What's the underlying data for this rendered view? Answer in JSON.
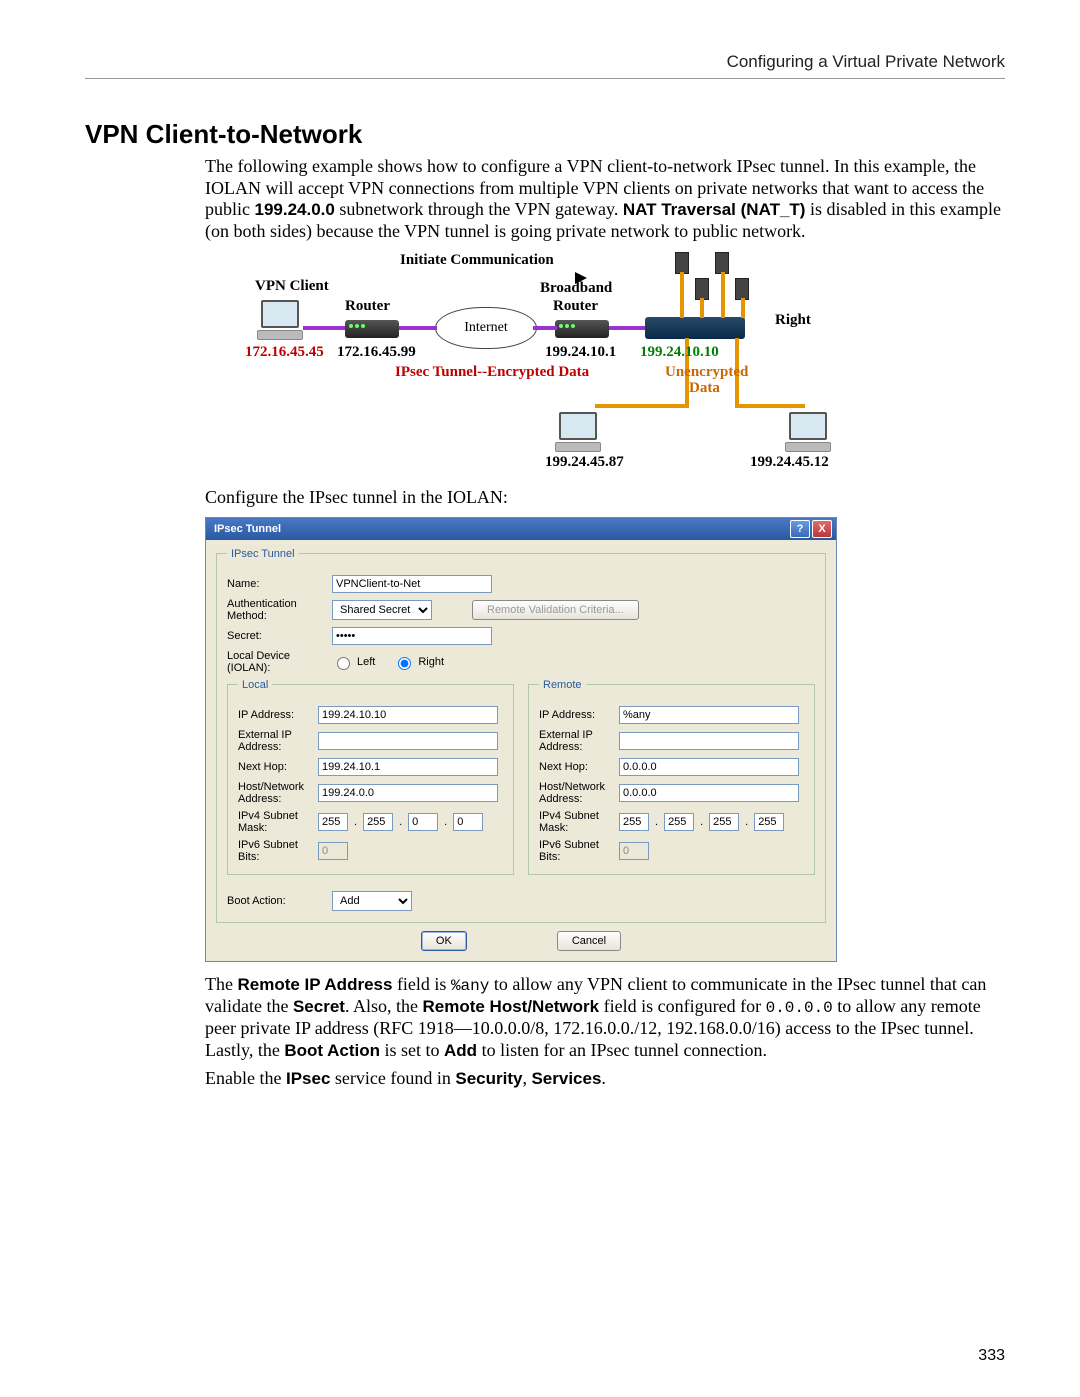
{
  "header": {
    "right": "Configuring a Virtual Private Network"
  },
  "section_title": "VPN Client-to-Network",
  "para1_a": "The following example shows how to configure a VPN client-to-network IPsec tunnel. In this example, the IOLAN will accept VPN connections from multiple VPN clients on private networks that want to access the public ",
  "para1_b_bold": "199.24.0.0",
  "para1_c": " subnetwork through the VPN gateway. ",
  "para1_d_bold": "NAT Traversal (NAT_T)",
  "para1_e": " is disabled in this example (on both sides) because the VPN tunnel is going private network to public network.",
  "diagram": {
    "initiate": "Initiate Communication",
    "vpn_client": "VPN Client",
    "router1": "Router",
    "broadband": "Broadband",
    "router2": "Router",
    "internet": "Internet",
    "right": "Right",
    "ip_vpnclient": "172.16.45.45",
    "ip_router1": "172.16.45.99",
    "ip_router2": "199.24.10.1",
    "ip_right": "199.24.10.10",
    "tunnel_label": "IPsec Tunnel--Encrypted Data",
    "unenc": "Unencrypted",
    "data": "Data",
    "ip_pc1": "199.24.45.87",
    "ip_pc2": "199.24.45.12"
  },
  "config_intro": "Configure the IPsec tunnel in the IOLAN:",
  "dialog": {
    "title": "IPsec Tunnel",
    "group_main": "IPsec Tunnel",
    "name_label": "Name:",
    "name_value": "VPNClient-to-Net",
    "auth_label": "Authentication Method:",
    "auth_value": "Shared Secret",
    "remote_validation_btn": "Remote Validation Criteria...",
    "secret_label": "Secret:",
    "secret_value": "•••••",
    "local_device_label": "Local Device (IOLAN):",
    "radio_left": "Left",
    "radio_right": "Right",
    "group_local": "Local",
    "group_remote": "Remote",
    "ip_addr": "IP Address:",
    "ext_ip": "External IP Address:",
    "next_hop": "Next Hop:",
    "hostnet": "Host/Network Address:",
    "v4mask": "IPv4 Subnet Mask:",
    "v6bits": "IPv6 Subnet Bits:",
    "local": {
      "ip": "199.24.10.10",
      "ext": "",
      "nexthop": "199.24.10.1",
      "hostnet": "199.24.0.0",
      "mask": [
        "255",
        "255",
        "0",
        "0"
      ],
      "v6": "0"
    },
    "remote": {
      "ip": "%any",
      "ext": "",
      "nexthop": "0.0.0.0",
      "hostnet": "0.0.0.0",
      "mask": [
        "255",
        "255",
        "255",
        "255"
      ],
      "v6": "0"
    },
    "boot_label": "Boot Action:",
    "boot_value": "Add",
    "ok": "OK",
    "cancel": "Cancel"
  },
  "para2_a": "The ",
  "para2_b_bold": "Remote IP Address",
  "para2_c": " field is ",
  "para2_d_code": "%any",
  "para2_e": " to allow any VPN client to communicate in the IPsec tunnel that can validate the ",
  "para2_f_bold": "Secret",
  "para2_g": ". Also, the ",
  "para2_h_bold": "Remote Host/Network",
  "para2_i": " field is configured for ",
  "para2_j_code": "0.0.0.0",
  "para2_k": " to allow any remote peer private IP address (RFC 1918—10.0.0.0/8, 172.16.0.0./12, 192.168.0.0/16) access to the IPsec tunnel. Lastly, the ",
  "para2_l_bold": "Boot Action",
  "para2_m": " is set to ",
  "para2_n_bold": "Add",
  "para2_o": " to listen for an IPsec tunnel connection.",
  "para3_a": "Enable the ",
  "para3_b_bold": "IPsec",
  "para3_c": " service found in ",
  "para3_d_bold": "Security",
  "para3_e": ", ",
  "para3_f_bold": "Services",
  "para3_g": ".",
  "page_number": "333"
}
